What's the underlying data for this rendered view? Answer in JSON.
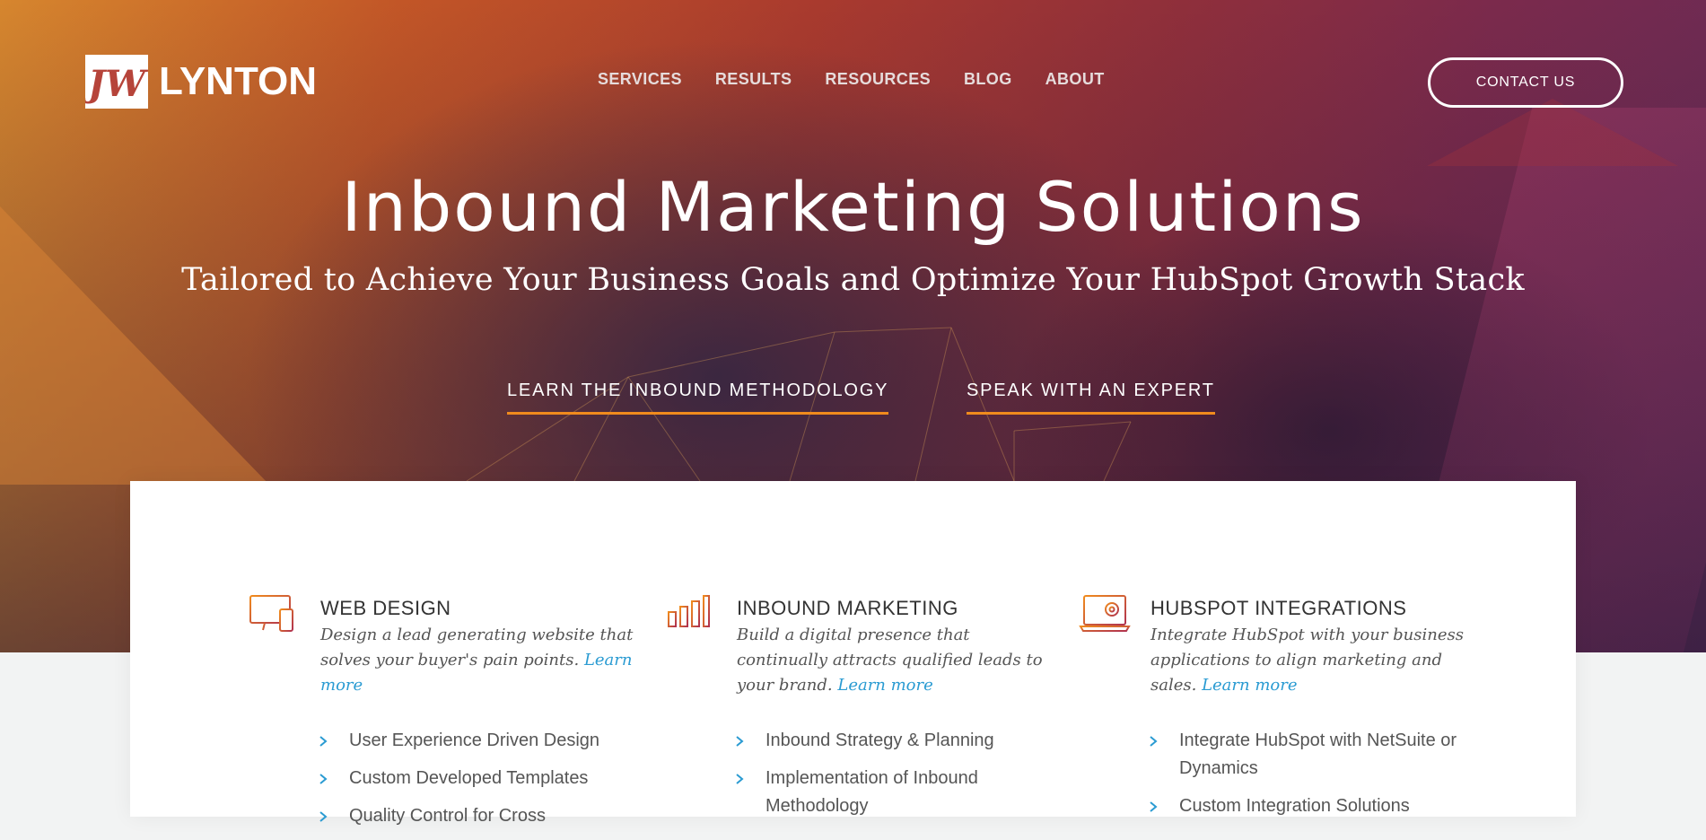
{
  "header": {
    "logo_mark": "JW",
    "logo_text": "LYNTON",
    "nav": [
      "SERVICES",
      "RESULTS",
      "RESOURCES",
      "BLOG",
      "ABOUT"
    ],
    "contact_label": "CONTACT US"
  },
  "hero": {
    "title": "Inbound Marketing Solutions",
    "subtitle": "Tailored to Achieve Your Business Goals and Optimize Your HubSpot Growth Stack",
    "cta_primary": "LEARN THE INBOUND METHODOLOGY",
    "cta_secondary": "SPEAK WITH AN EXPERT"
  },
  "colors": {
    "accent_orange": "#f08b1d",
    "link_blue": "#2a9bd2",
    "icon_gradient_start": "#f08b1d",
    "icon_gradient_end": "#b0324f"
  },
  "services": [
    {
      "icon": "devices-icon",
      "title": "WEB DESIGN",
      "description": "Design a lead generating website that solves your buyer's pain points.",
      "link": "Learn more",
      "bullets": [
        "User Experience Driven Design",
        "Custom Developed Templates",
        "Quality Control for Cross"
      ]
    },
    {
      "icon": "bar-chart-icon",
      "title": "INBOUND MARKETING",
      "description": "Build a digital presence that continually attracts qualified leads to your brand.",
      "link": "Learn more",
      "bullets": [
        "Inbound Strategy & Planning",
        "Implementation of Inbound Methodology"
      ]
    },
    {
      "icon": "laptop-gear-icon",
      "title": "HUBSPOT INTEGRATIONS",
      "description": "Integrate HubSpot with your business applications to align marketing and sales.",
      "link": "Learn more",
      "bullets": [
        "Integrate HubSpot with NetSuite or Dynamics",
        "Custom Integration Solutions"
      ]
    }
  ]
}
